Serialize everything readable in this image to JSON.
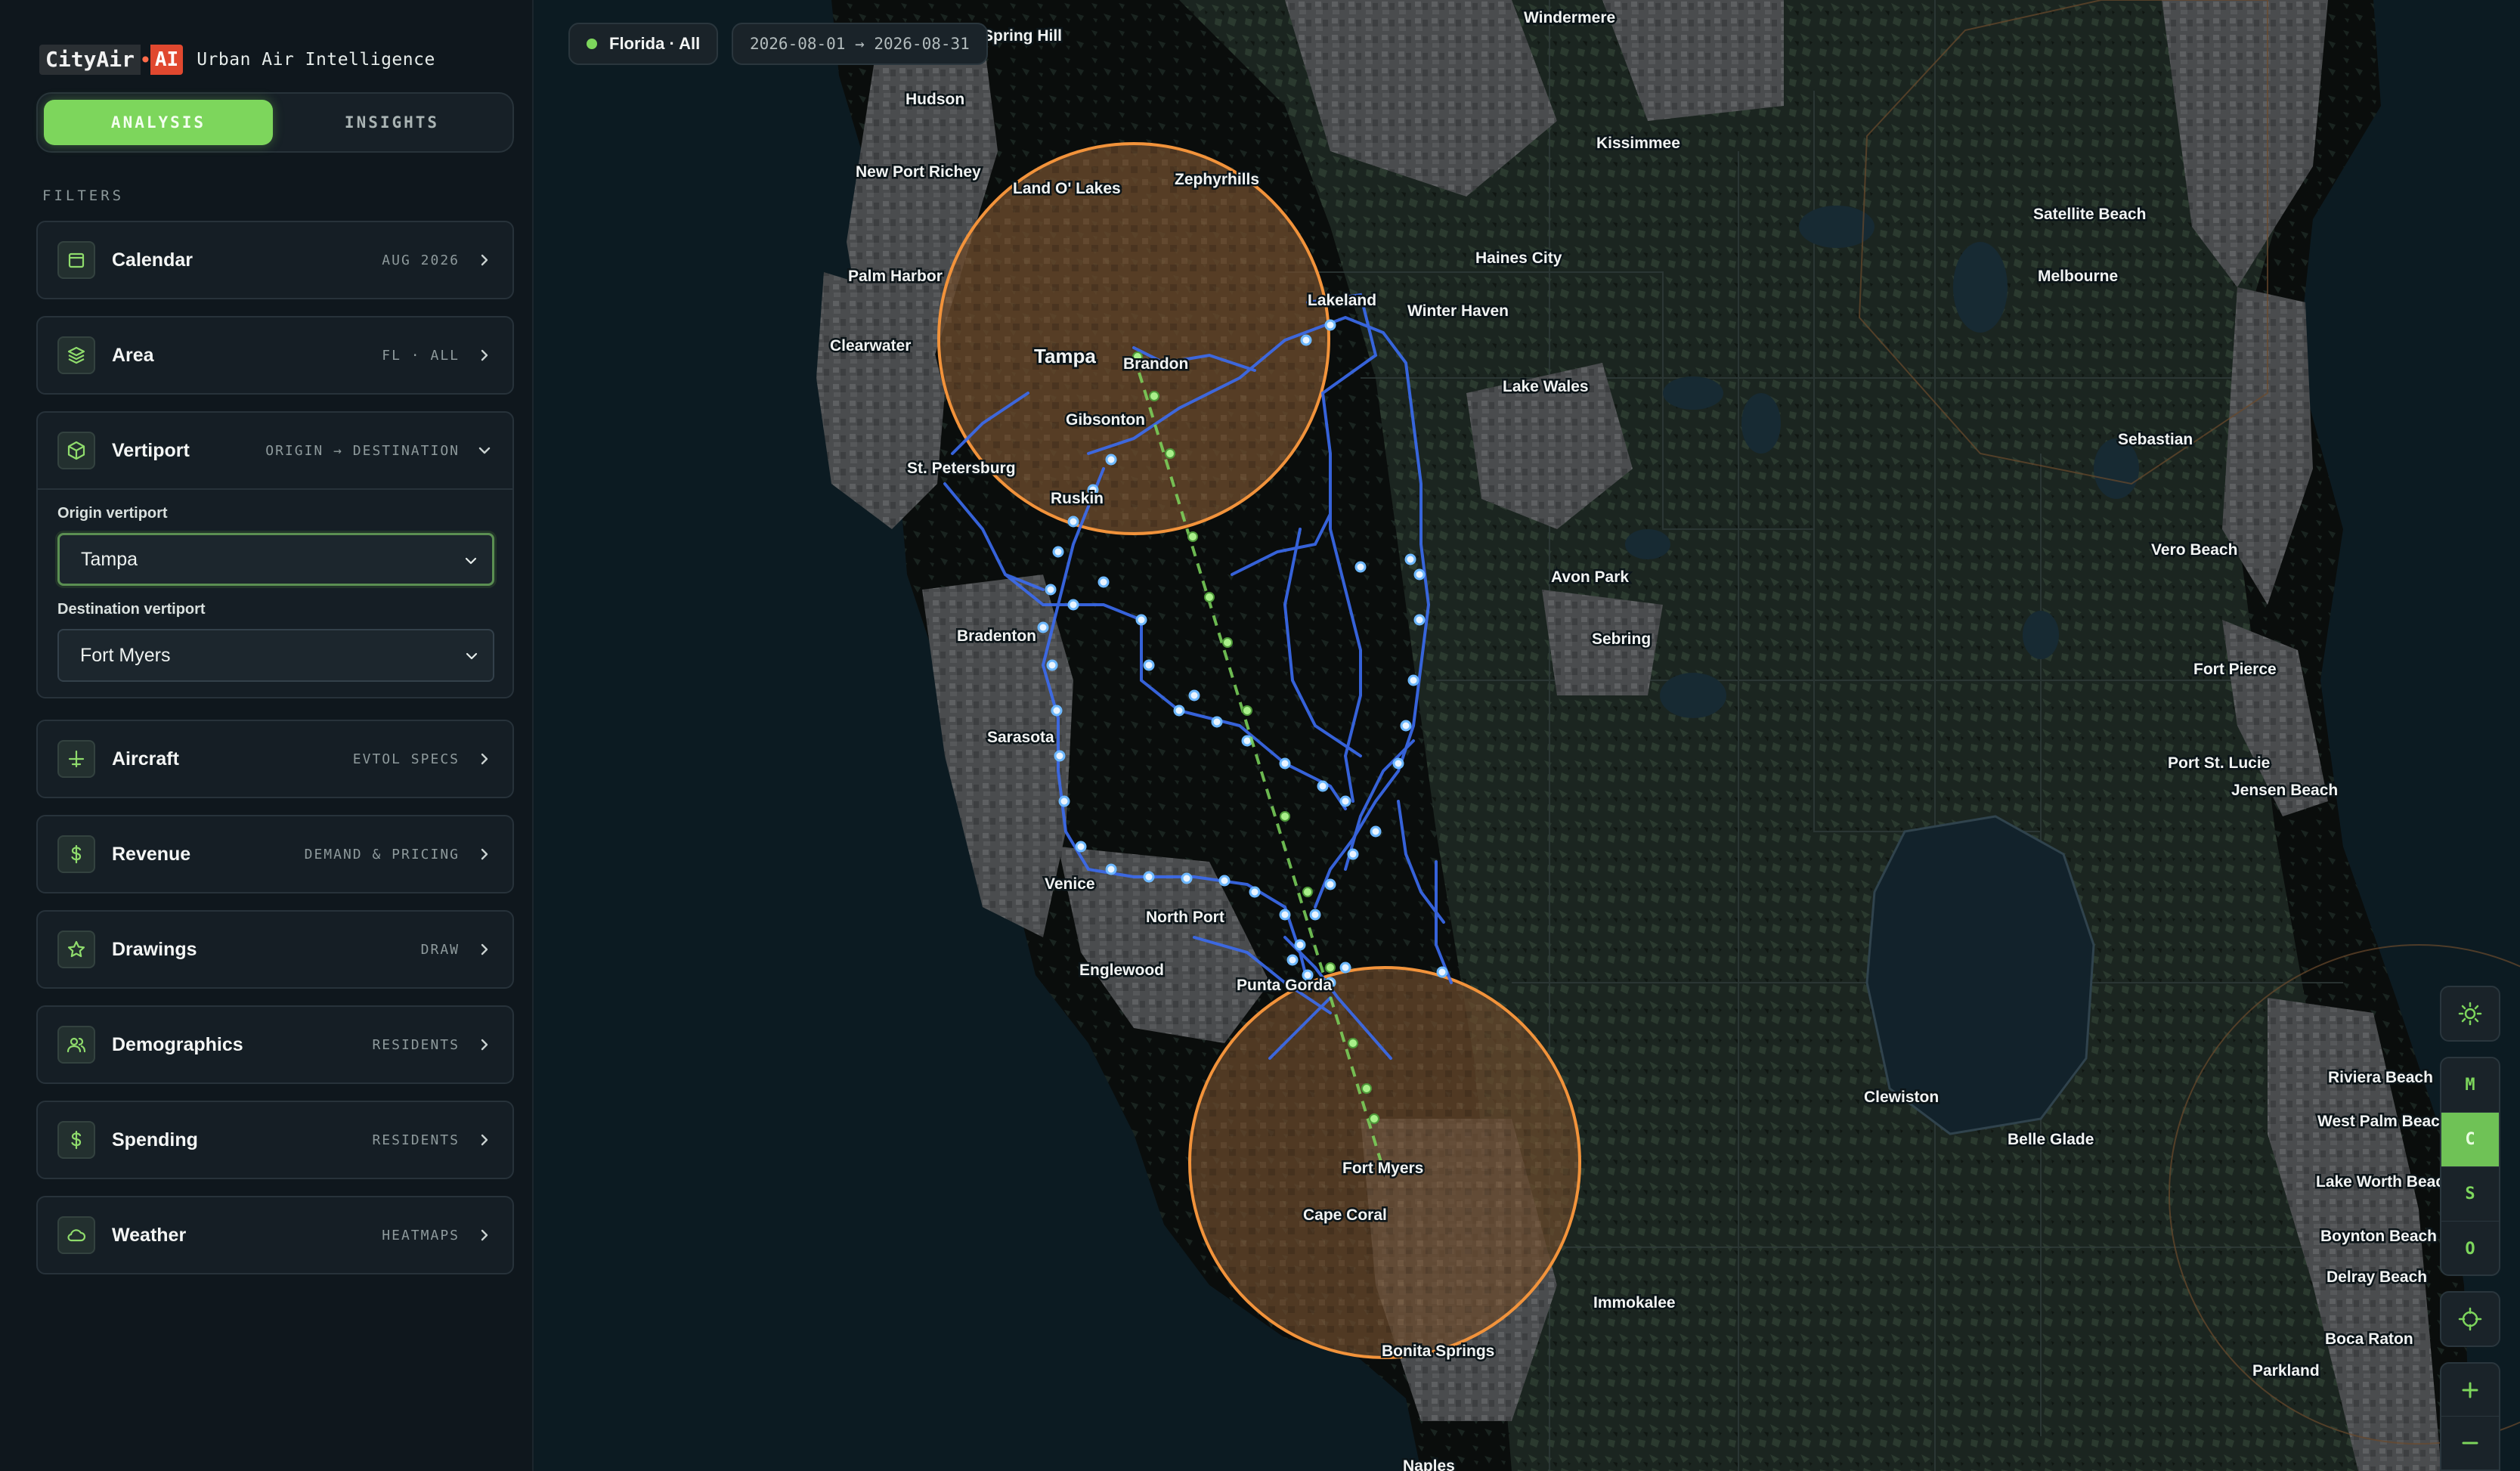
{
  "brand": {
    "name": "CityAir",
    "ai": "AI",
    "tagline": "Urban Air Intelligence"
  },
  "tabs": [
    {
      "label": "ANALYSIS",
      "active": true
    },
    {
      "label": "INSIGHTS",
      "active": false
    }
  ],
  "filters_label": "FILTERS",
  "filters": {
    "calendar": {
      "title": "Calendar",
      "meta": "AUG 2026",
      "icon": "calendar-icon"
    },
    "area": {
      "title": "Area",
      "meta": "FL · ALL",
      "icon": "layers-icon"
    },
    "vertiport": {
      "title": "Vertiport",
      "meta": "ORIGIN → DESTINATION",
      "icon": "cube-icon",
      "origin_label": "Origin vertiport",
      "origin_value": "Tampa",
      "destination_label": "Destination vertiport",
      "destination_value": "Fort Myers"
    },
    "aircraft": {
      "title": "Aircraft",
      "meta": "EVTOL SPECS",
      "icon": "aircraft-icon"
    },
    "revenue": {
      "title": "Revenue",
      "meta": "DEMAND & PRICING",
      "icon": "dollar-icon"
    },
    "drawings": {
      "title": "Drawings",
      "meta": "DRAW",
      "icon": "star-shape-icon"
    },
    "demographics": {
      "title": "Demographics",
      "meta": "RESIDENTS",
      "icon": "users-icon"
    },
    "spending": {
      "title": "Spending",
      "meta": "RESIDENTS",
      "icon": "dollar-icon"
    },
    "weather": {
      "title": "Weather",
      "meta": "HEATMAPS",
      "icon": "cloud-icon"
    }
  },
  "topbar": {
    "region": "Florida · All",
    "date_range": "2026-08-01 → 2026-08-31"
  },
  "map_modes": [
    "M",
    "C",
    "S",
    "O"
  ],
  "active_map_mode": "C",
  "colors": {
    "accent": "#7dd65c",
    "route": "#3b6cf0",
    "corridor": "#7dd65c",
    "radius": "#f0923a"
  },
  "map": {
    "places": [
      "Windermere",
      "Spring Hill",
      "Hudson",
      "Kissimmee",
      "New Port Richey",
      "Land O' Lakes",
      "Zephyrhills",
      "Satellite Beach",
      "Haines City",
      "Palm Harbor",
      "Melbourne",
      "Lakeland",
      "Winter Haven",
      "Clearwater",
      "Tampa",
      "Brandon",
      "Lake Wales",
      "Gibsonton",
      "Sebastian",
      "St. Petersburg",
      "Ruskin",
      "Vero Beach",
      "Avon Park",
      "Bradenton",
      "Sebring",
      "Fort Pierce",
      "Sarasota",
      "Port St. Lucie",
      "Jensen Beach",
      "Venice",
      "North Port",
      "Englewood",
      "Punta Gorda",
      "Riviera Beach",
      "Clewiston",
      "West Palm Beach",
      "Belle Glade",
      "Fort Myers",
      "Lake Worth Beach",
      "Cape Coral",
      "Boynton Beach",
      "Immokalee",
      "Delray Beach",
      "Boca Raton",
      "Bonita Springs",
      "Parkland",
      "Naples"
    ]
  }
}
